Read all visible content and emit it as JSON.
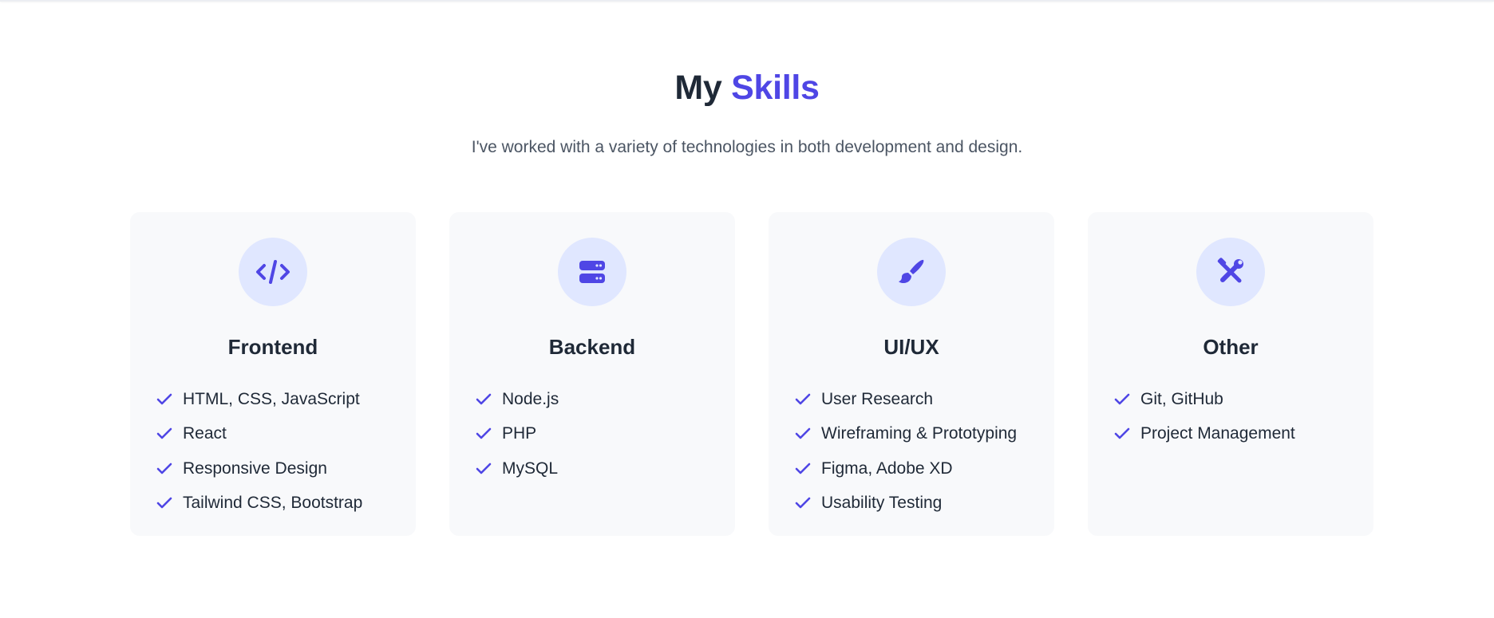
{
  "header": {
    "title_part1": "My",
    "title_part2": "Skills",
    "subtitle": "I've worked with a variety of technologies in both development and design."
  },
  "colors": {
    "accent": "#4f46e5",
    "icon_bg": "#e0e7ff",
    "card_bg": "#f8f9fb",
    "text": "#1f2937",
    "muted": "#4b5563"
  },
  "cards": [
    {
      "title": "Frontend",
      "icon": "code-icon",
      "skills": [
        "HTML, CSS, JavaScript",
        "React",
        "Responsive Design",
        "Tailwind CSS, Bootstrap"
      ]
    },
    {
      "title": "Backend",
      "icon": "server-icon",
      "skills": [
        "Node.js",
        "PHP",
        "MySQL"
      ]
    },
    {
      "title": "UI/UX",
      "icon": "paintbrush-icon",
      "skills": [
        "User Research",
        "Wireframing & Prototyping",
        "Figma, Adobe XD",
        "Usability Testing"
      ]
    },
    {
      "title": "Other",
      "icon": "tools-icon",
      "skills": [
        "Git, GitHub",
        "Project Management"
      ]
    }
  ]
}
